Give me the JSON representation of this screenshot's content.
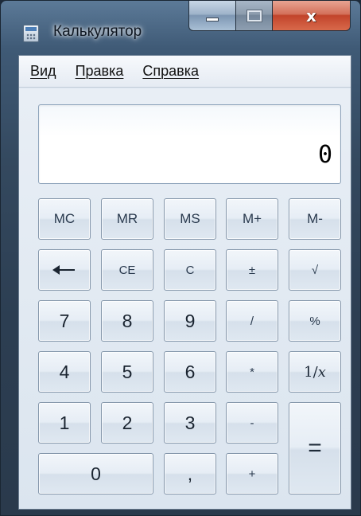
{
  "window": {
    "title": "Калькулятор",
    "controls": {
      "minimize": "",
      "maximize": "",
      "close": "x"
    }
  },
  "menu": [
    "Вид",
    "Правка",
    "Справка"
  ],
  "display": {
    "value": "0"
  },
  "buttons": {
    "mc": "MC",
    "mr": "MR",
    "ms": "MS",
    "mplus": "M+",
    "mminus": "M-",
    "backspace_icon": "backspace-arrow",
    "ce": "CE",
    "c": "C",
    "plusminus": "±",
    "sqrt": "√",
    "seven": "7",
    "eight": "8",
    "nine": "9",
    "divide": "/",
    "percent": "%",
    "four": "4",
    "five": "5",
    "six": "6",
    "multiply": "*",
    "reciprocal_num": "1/",
    "reciprocal_var": "x",
    "one": "1",
    "two": "2",
    "three": "3",
    "minus": "-",
    "equals": "=",
    "zero": "0",
    "decimal": ",",
    "plus": "+"
  }
}
